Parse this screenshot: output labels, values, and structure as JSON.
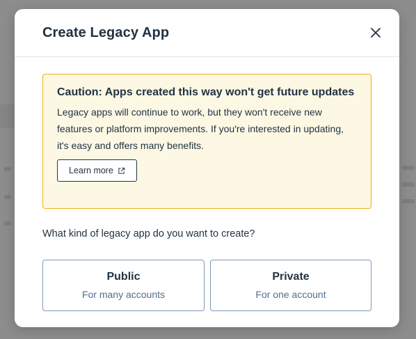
{
  "modal": {
    "title": "Create Legacy App",
    "close_icon": "close-icon"
  },
  "alert": {
    "title": "Caution: Apps created this way won't get future updates",
    "text": "Legacy apps will continue to work, but they won't receive new features or platform improvements. If you're interested in updating, it's easy and offers many benefits.",
    "learn_more_label": "Learn more",
    "learn_more_icon": "external-link-icon",
    "background_color": "#fdf8e4",
    "border_color": "#eeb117"
  },
  "question": "What kind of legacy app do you want to create?",
  "options": [
    {
      "title": "Public",
      "subtitle": "For many accounts"
    },
    {
      "title": "Private",
      "subtitle": "For one account"
    }
  ],
  "colors": {
    "text": "#213343",
    "subtext": "#516f90",
    "card_border": "#7c98b6",
    "overlay": "#8c8c8c"
  }
}
